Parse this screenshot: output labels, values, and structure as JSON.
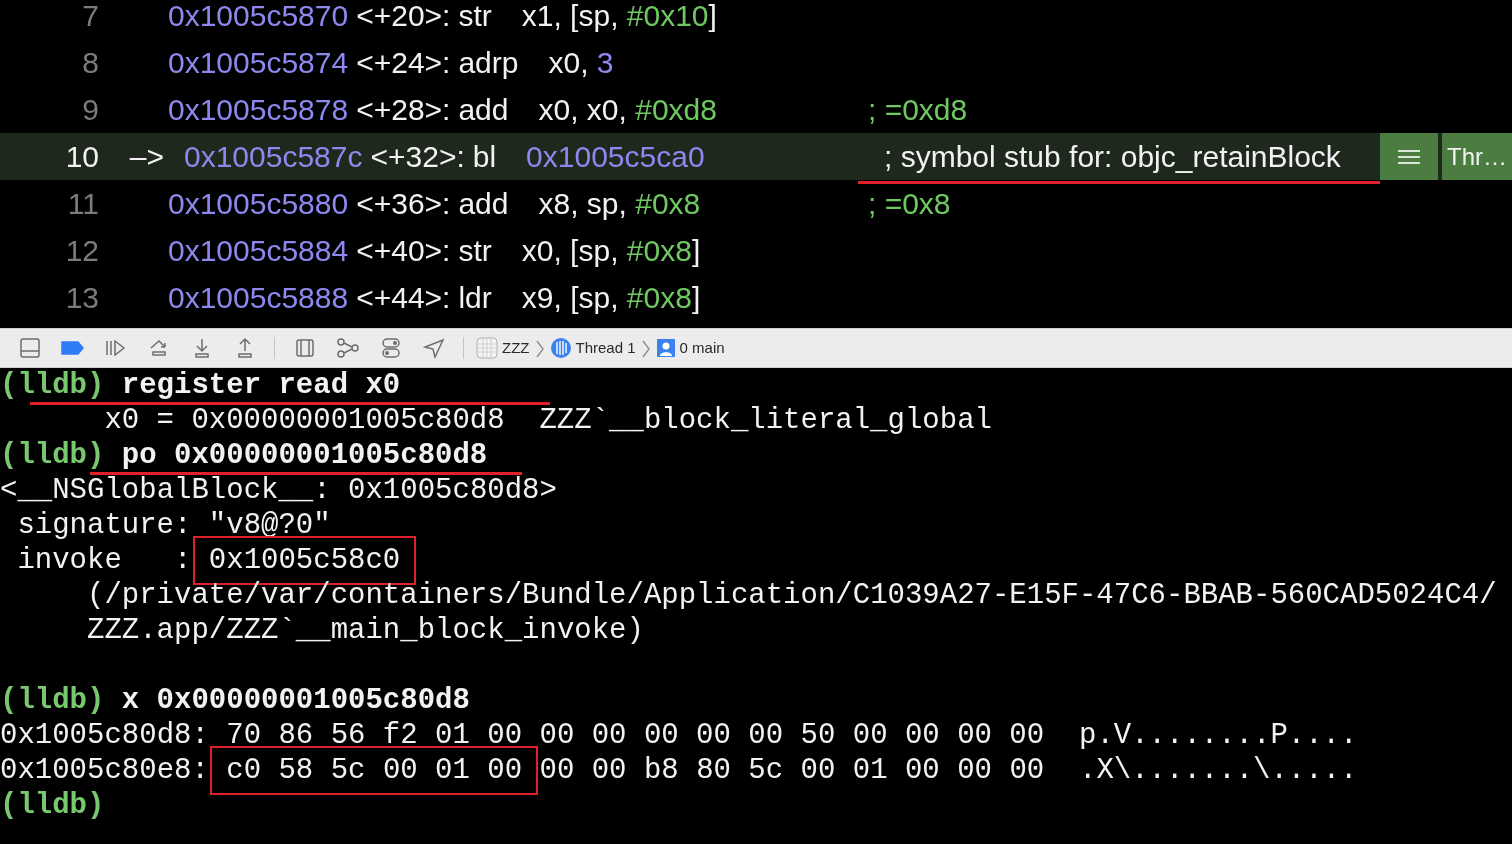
{
  "disassembly": {
    "lines": [
      {
        "number": "7",
        "current": false,
        "address": "0x1005c5870",
        "offset": "<+20>:",
        "mnemonic": "str",
        "operands": [
          {
            "text": "x1, [sp, ",
            "kind": "plain"
          },
          {
            "text": "#0x10",
            "kind": "immediate"
          },
          {
            "text": "]",
            "kind": "plain"
          }
        ]
      },
      {
        "number": "8",
        "current": false,
        "address": "0x1005c5874",
        "offset": "<+24>:",
        "mnemonic": "adrp",
        "operands": [
          {
            "text": "x0, ",
            "kind": "plain"
          },
          {
            "text": "3",
            "kind": "number"
          }
        ]
      },
      {
        "number": "9",
        "current": false,
        "address": "0x1005c5878",
        "offset": "<+28>:",
        "mnemonic": "add",
        "operands": [
          {
            "text": "x0, x0, ",
            "kind": "plain"
          },
          {
            "text": "#0xd8",
            "kind": "immediate"
          }
        ],
        "comment": {
          "text": "; =0xd8",
          "kind": "value",
          "underlined": false
        }
      },
      {
        "number": "10",
        "current": true,
        "arrow": "–>",
        "address": "0x1005c587c",
        "offset": "<+32>:",
        "mnemonic": "bl",
        "operands": [
          {
            "text": "0x1005c5ca0",
            "kind": "number"
          }
        ],
        "comment": {
          "text": "; symbol stub for: objc_retainBlock",
          "kind": "symbol",
          "underlined": true
        },
        "thread_badge": "Thr…"
      },
      {
        "number": "11",
        "current": false,
        "address": "0x1005c5880",
        "offset": "<+36>:",
        "mnemonic": "add",
        "operands": [
          {
            "text": "x8, sp, ",
            "kind": "plain"
          },
          {
            "text": "#0x8",
            "kind": "immediate"
          }
        ],
        "comment": {
          "text": "; =0x8",
          "kind": "value",
          "underlined": false
        }
      },
      {
        "number": "12",
        "current": false,
        "address": "0x1005c5884",
        "offset": "<+40>:",
        "mnemonic": "str",
        "operands": [
          {
            "text": "x0, [sp, ",
            "kind": "plain"
          },
          {
            "text": "#0x8",
            "kind": "immediate"
          },
          {
            "text": "]",
            "kind": "plain"
          }
        ]
      },
      {
        "number": "13",
        "current": false,
        "address": "0x1005c5888",
        "offset": "<+44>:",
        "mnemonic": "ldr",
        "operands": [
          {
            "text": "x9, [sp, ",
            "kind": "plain"
          },
          {
            "text": "#0x8",
            "kind": "immediate"
          },
          {
            "text": "]",
            "kind": "plain"
          }
        ]
      }
    ]
  },
  "debug_bar": {
    "breakpoints_active": true,
    "breadcrumbs": [
      {
        "label": "ZZZ",
        "kind": "app"
      },
      {
        "label": "Thread 1",
        "kind": "thread"
      },
      {
        "label": "0 main",
        "kind": "frame"
      }
    ]
  },
  "console": {
    "lines": [
      {
        "kind": "command",
        "prompt": "(lldb)",
        "command": "register read x0",
        "underlined": true
      },
      {
        "kind": "register",
        "segments": [
          {
            "text": "x0 = 0x00000001005c80d8  ZZZ`__block_literal_global",
            "boxed": false
          }
        ]
      },
      {
        "kind": "command",
        "prompt": "(lldb)",
        "command": "po 0x00000001005c80d8",
        "underlined": true
      },
      {
        "kind": "result",
        "segments": [
          {
            "text": "<__NSGlobalBlock__: 0x1005c80d8>",
            "boxed": false
          }
        ]
      },
      {
        "kind": "field",
        "segments": [
          {
            "text": "signature: \"v8@?0\"",
            "boxed": false
          }
        ]
      },
      {
        "kind": "field",
        "segments": [
          {
            "text": "invoke   : ",
            "boxed": false
          },
          {
            "text": "0x1005c58c0",
            "boxed": true
          }
        ]
      },
      {
        "kind": "path",
        "segments": [
          {
            "text": "(/private/var/containers/Bundle/Application/C1039A27-E15F-47C6-BBAB-560CAD5024C4/",
            "boxed": false
          }
        ]
      },
      {
        "kind": "path",
        "segments": [
          {
            "text": "ZZZ.app/ZZZ`__main_block_invoke)",
            "boxed": false
          }
        ]
      },
      {
        "kind": "blank"
      },
      {
        "kind": "command",
        "prompt": "(lldb)",
        "command": "x 0x00000001005c80d8",
        "underlined": false
      },
      {
        "kind": "result",
        "segments": [
          {
            "text": "0x1005c80d8: 70 86 56 f2 01 00 00 00 00 00 00 50 00 00 00 00  p.V........P....",
            "boxed": false
          }
        ]
      },
      {
        "kind": "result",
        "segments": [
          {
            "text": "0x1005c80e8: ",
            "boxed": false
          },
          {
            "text": "c0 58 5c 00 01 00",
            "boxed": true
          },
          {
            "text": " 00 00 b8 80 5c 00 01 00 00 00  .X\\.......\\.....",
            "boxed": false
          }
        ]
      },
      {
        "kind": "command",
        "prompt": "(lldb)",
        "underlined": false
      }
    ]
  }
}
